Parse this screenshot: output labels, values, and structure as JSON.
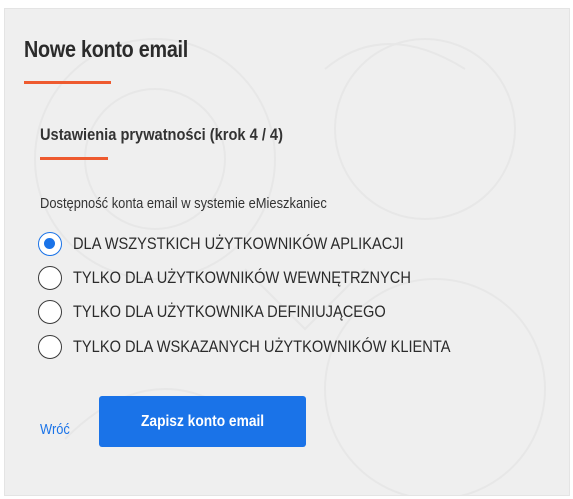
{
  "form": {
    "title": "Nowe konto email",
    "step_title": "Ustawienia prywatności (krok 4 / 4)",
    "field_label": "Dostępność konta email w systemie eMieszkaniec",
    "options": [
      {
        "label": "DLA WSZYSTKICH UŻYTKOWNIKÓW APLIKACJI",
        "checked": true
      },
      {
        "label": "TYLKO DLA UŻYTKOWNIKÓW WEWNĘTRZNYCH",
        "checked": false
      },
      {
        "label": "TYLKO DLA UŻYTKOWNIKA DEFINIUJĄCEGO",
        "checked": false
      },
      {
        "label": "TYLKO DLA WSKAZANYCH UŻYTKOWNIKÓW KLIENTA",
        "checked": false
      }
    ],
    "back_label": "Wróć",
    "save_label": "Zapisz konto email"
  },
  "colors": {
    "accent_underline": "#ee5a2f",
    "primary": "#1a73e8",
    "panel_background": "#efefef"
  }
}
